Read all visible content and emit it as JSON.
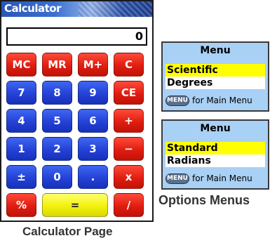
{
  "calculator": {
    "title": "Calculator",
    "display_value": "0",
    "keys": [
      {
        "label": "MC",
        "color": "red"
      },
      {
        "label": "MR",
        "color": "red"
      },
      {
        "label": "M+",
        "color": "red"
      },
      {
        "label": "C",
        "color": "red"
      },
      {
        "label": "7",
        "color": "blue"
      },
      {
        "label": "8",
        "color": "blue"
      },
      {
        "label": "9",
        "color": "blue"
      },
      {
        "label": "CE",
        "color": "red"
      },
      {
        "label": "4",
        "color": "blue"
      },
      {
        "label": "5",
        "color": "blue"
      },
      {
        "label": "6",
        "color": "blue"
      },
      {
        "label": "+",
        "color": "red"
      },
      {
        "label": "1",
        "color": "blue"
      },
      {
        "label": "2",
        "color": "blue"
      },
      {
        "label": "3",
        "color": "blue"
      },
      {
        "label": "−",
        "color": "red"
      },
      {
        "label": "±",
        "color": "blue"
      },
      {
        "label": "0",
        "color": "blue"
      },
      {
        "label": ".",
        "color": "blue"
      },
      {
        "label": "x",
        "color": "red"
      },
      {
        "label": "%",
        "color": "red"
      },
      {
        "label": "=",
        "color": "yellow"
      },
      {
        "label": "/",
        "color": "red"
      }
    ],
    "caption": "Calculator Page"
  },
  "menu_top": {
    "title": "Menu",
    "options": [
      "Scientific",
      "Degrees"
    ],
    "selected": "Scientific",
    "hint_key": "MENU",
    "hint_text": "for Main Menu"
  },
  "menu_bottom": {
    "title": "Menu",
    "options": [
      "Standard",
      "Radians"
    ],
    "selected": "Standard",
    "hint_key": "MENU",
    "hint_text": "for Main Menu"
  },
  "options_caption": "Options Menus",
  "colors": {
    "title_bar": "#2a56b8",
    "key_red": "#e01d10",
    "key_blue": "#2442d6",
    "key_yellow": "#f2f20c",
    "menu_background": "#a9d0f5",
    "menu_selected": "#ffff00"
  }
}
